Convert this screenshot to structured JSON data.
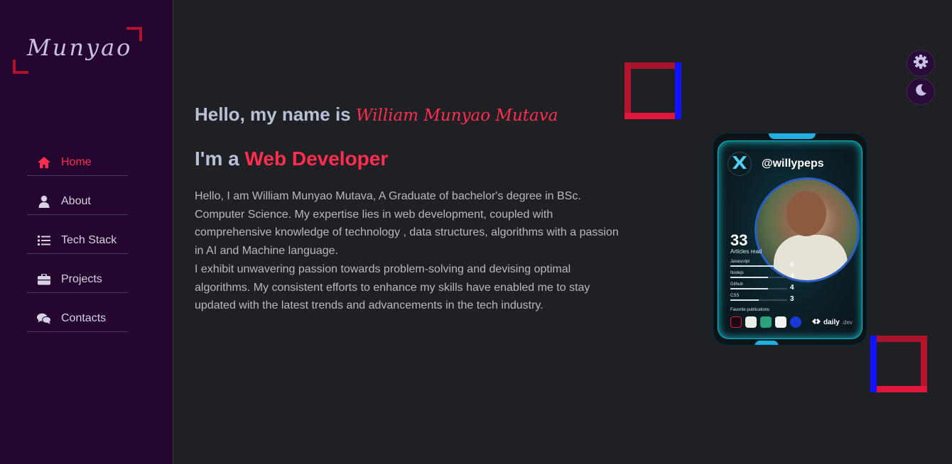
{
  "logo": {
    "text": "Munyao"
  },
  "nav": {
    "items": [
      {
        "label": "Home",
        "icon": "home-icon",
        "active": true
      },
      {
        "label": "About",
        "icon": "user-icon",
        "active": false
      },
      {
        "label": "Tech Stack",
        "icon": "list-icon",
        "active": false
      },
      {
        "label": "Projects",
        "icon": "briefcase-icon",
        "active": false
      },
      {
        "label": "Contacts",
        "icon": "chat-icon",
        "active": false
      }
    ]
  },
  "hero": {
    "greeting": "Hello, my name is",
    "name": "William Munyao Mutava",
    "role_prefix": "I'm a",
    "role": "Web Developer",
    "bio_1": "Hello, I am William Munyao Mutava, A Graduate of bachelor's degree in BSc. Computer Science. My expertise lies in web development, coupled with comprehensive knowledge of technology , data structures, algorithms with a passion in AI and Machine language.",
    "bio_2": "I exhibit unwavering passion towards problem-solving and devising optimal algorithms. My consistent efforts to enhance my skills have enabled me to stay updated with the latest trends and advancements in the tech industry."
  },
  "controls": {
    "settings_icon": "gear-icon",
    "theme_icon": "moon-icon"
  },
  "devcard": {
    "handle": "@willypeps",
    "articles_count": "33",
    "articles_label": "Articles read",
    "stats": [
      {
        "label": "Javascript",
        "value": "6"
      },
      {
        "label": "Nodejs",
        "value": "4"
      },
      {
        "label": "Github",
        "value": "4"
      },
      {
        "label": "CSS",
        "value": "3"
      }
    ],
    "favorites_label": "Favorite publications",
    "brand_main": "daily",
    "brand_sub": ".dev"
  },
  "colors": {
    "accent": "#ff2d4f",
    "sidebar_bg": "#24062f",
    "main_bg": "#1f2023"
  }
}
